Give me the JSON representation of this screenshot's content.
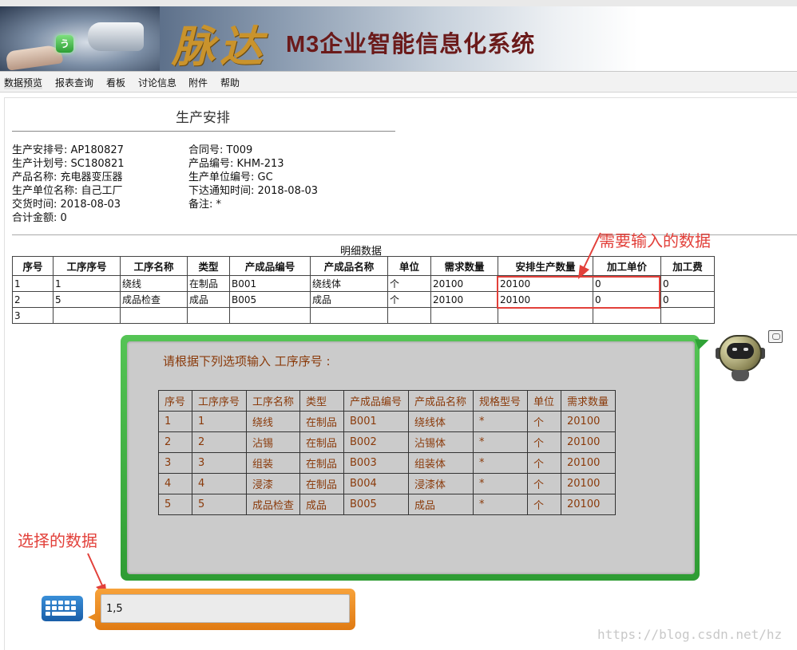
{
  "banner": {
    "badge": "う",
    "logo_text": "脉达",
    "title": "M3企业智能信息化系统"
  },
  "menu": [
    "数据预览",
    "报表查询",
    "看板",
    "讨论信息",
    "附件",
    "帮助"
  ],
  "form": {
    "title": "生产安排",
    "fields": [
      {
        "label": "生产安排号:",
        "value": "AP180827"
      },
      {
        "label": "生产计划号:",
        "value": "SC180821"
      },
      {
        "label": "产品名称:",
        "value": "充电器变压器"
      },
      {
        "label": "生产单位名称:",
        "value": "自己工厂"
      },
      {
        "label": "交货时间:",
        "value": "2018-08-03"
      },
      {
        "label": "合计金额:",
        "value": "0"
      },
      {
        "label": "合同号:",
        "value": "T009"
      },
      {
        "label": "产品编号:",
        "value": "KHM-213"
      },
      {
        "label": "生产单位编号:",
        "value": "GC"
      },
      {
        "label": "下达通知时间:",
        "value": "2018-08-03"
      },
      {
        "label": "备注:",
        "value": "*"
      }
    ]
  },
  "detail": {
    "caption": "明细数据",
    "headers": [
      "序号",
      "工序序号",
      "工序名称",
      "类型",
      "产成品编号",
      "产成品名称",
      "单位",
      "需求数量",
      "安排生产数量",
      "加工单价",
      "加工费"
    ],
    "rows": [
      [
        "1",
        "1",
        "绕线",
        "在制品",
        "B001",
        "绕线体",
        "个",
        "20100",
        "20100",
        "0",
        "0"
      ],
      [
        "2",
        "5",
        "成品检查",
        "成品",
        "B005",
        "成品",
        "个",
        "20100",
        "20100",
        "0",
        "0"
      ],
      [
        "3",
        "",
        "",
        "",
        "",
        "",
        "",
        "",
        "",
        "",
        ""
      ]
    ]
  },
  "annotations": {
    "input_needed": "需要输入的数据",
    "selected": "选择的数据"
  },
  "dialog": {
    "prompt": "请根据下列选项输入 工序序号 :",
    "headers": [
      "序号",
      "工序序号",
      "工序名称",
      "类型",
      "产成品编号",
      "产成品名称",
      "规格型号",
      "单位",
      "需求数量"
    ],
    "rows": [
      [
        "1",
        "1",
        "绕线",
        "在制品",
        "B001",
        "绕线体",
        "*",
        "个",
        "20100"
      ],
      [
        "2",
        "2",
        "沾锡",
        "在制品",
        "B002",
        "沾锡体",
        "*",
        "个",
        "20100"
      ],
      [
        "3",
        "3",
        "组装",
        "在制品",
        "B003",
        "组装体",
        "*",
        "个",
        "20100"
      ],
      [
        "4",
        "4",
        "浸漆",
        "在制品",
        "B004",
        "浸漆体",
        "*",
        "个",
        "20100"
      ],
      [
        "5",
        "5",
        "成品检查",
        "成品",
        "B005",
        "成品",
        "*",
        "个",
        "20100"
      ]
    ]
  },
  "input": {
    "value": "1,5"
  },
  "watermark": "https://blog.csdn.net/hz",
  "colors": {
    "annotation": "#e2403a",
    "dialog_border": "#2e9c33",
    "input_border": "#e07a12",
    "dialog_text": "#8a3a0a"
  },
  "icons": [
    "robot-assistant-icon",
    "chat-bubble-icon",
    "keyboard-icon"
  ]
}
